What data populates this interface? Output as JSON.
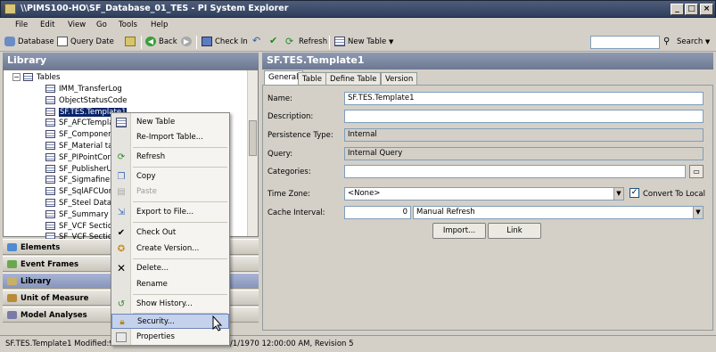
{
  "window": {
    "title": "\\\\PIMS100-HO\\SF_Database_01_TES - PI System Explorer"
  },
  "menu": [
    "File",
    "Edit",
    "View",
    "Go",
    "Tools",
    "Help"
  ],
  "toolbar": {
    "database": "Database",
    "query_date": "Query Date",
    "back": "Back",
    "check_in": "Check In",
    "refresh": "Refresh",
    "new_table": "New Table",
    "search": "Search"
  },
  "library": {
    "header": "Library",
    "tree_root": "Tables",
    "items": [
      "IMM_TransferLog",
      "ObjectStatusCode",
      "SF.TES.Template1",
      "SF_AFCTemplat",
      "SF_Component",
      "SF_Material tab",
      "SF_PIPointConf",
      "SF_PublisherU",
      "SF_SigmafineB",
      "SF_SqlAFCUom",
      "SF_Steel Data",
      "SF_Summary ta",
      "SF_VCF Section",
      "SF_VCF Section"
    ]
  },
  "navigator": [
    "Elements",
    "Event Frames",
    "Library",
    "Unit of Measure",
    "Model Analyses"
  ],
  "detail": {
    "header": "SF.TES.Template1",
    "tabs": [
      "General",
      "Table",
      "Define Table",
      "Version"
    ],
    "labels": {
      "name": "Name:",
      "description": "Description:",
      "persistence": "Persistence Type:",
      "query": "Query:",
      "categories": "Categories:",
      "timezone": "Time Zone:",
      "cache": "Cache Interval:"
    },
    "values": {
      "name": "SF.TES.Template1",
      "description": "",
      "persistence": "Internal",
      "query": "Internal Query",
      "categories": "",
      "timezone": "<None>",
      "convert_local": "Convert To Local",
      "cache_number": "0",
      "cache_mode": "Manual Refresh"
    },
    "buttons": {
      "import": "Import...",
      "link": "Link"
    }
  },
  "context_menu": [
    "New Table",
    "Re-Import Table...",
    "Refresh",
    "Copy",
    "Paste",
    "Export to File...",
    "Check Out",
    "Create Version...",
    "Delete...",
    "Rename",
    "Show History...",
    "Security...",
    "Properties"
  ],
  "status": {
    "text": "SF.TES.Template1 Modified:9",
    "text2": "/1/1970 12:00:00 AM, Revision 5"
  }
}
